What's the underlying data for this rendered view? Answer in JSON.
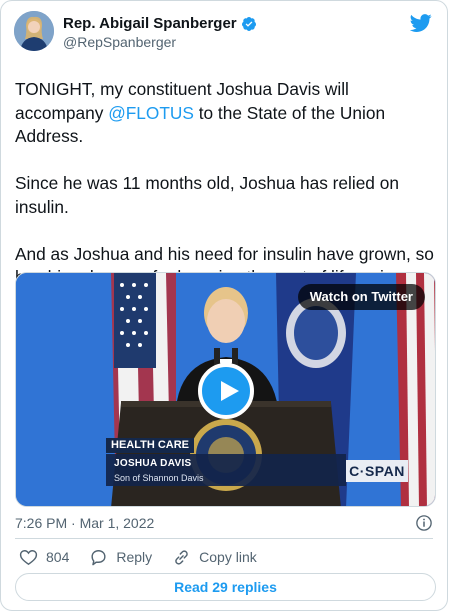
{
  "author": {
    "display_name": "Rep. Abigail Spanberger",
    "handle": "@RepSpanberger",
    "verified": true
  },
  "tweet": {
    "text_parts": [
      "TONIGHT, my constituent Joshua Davis will accompany ",
      "@FLOTUS",
      " to the State of the Union Address.\n\nSince he was 11 months old, Joshua has relied on insulin.\n\nAnd as Joshua and his need for insulin have grown, so has his advocacy for lowering the cost of lifesaving medications."
    ]
  },
  "media": {
    "watch_label": "Watch on Twitter",
    "tag": "HEALTH CARE",
    "name": "JOSHUA DAVIS",
    "subtitle": "Son of Shannon Davis",
    "network": "C·SPAN"
  },
  "meta": {
    "timestamp": "7:26 PM · Mar 1, 2022"
  },
  "actions": {
    "like_count": "804",
    "reply_label": "Reply",
    "copy_link_label": "Copy link"
  },
  "read_replies_label": "Read 29 replies",
  "colors": {
    "accent": "#1d9bf0",
    "secondary_text": "#536471",
    "border": "#cfd9de"
  },
  "icons": [
    "twitter-bird-icon",
    "verified-badge-icon",
    "play-icon",
    "info-icon",
    "heart-icon",
    "reply-icon",
    "link-icon"
  ]
}
